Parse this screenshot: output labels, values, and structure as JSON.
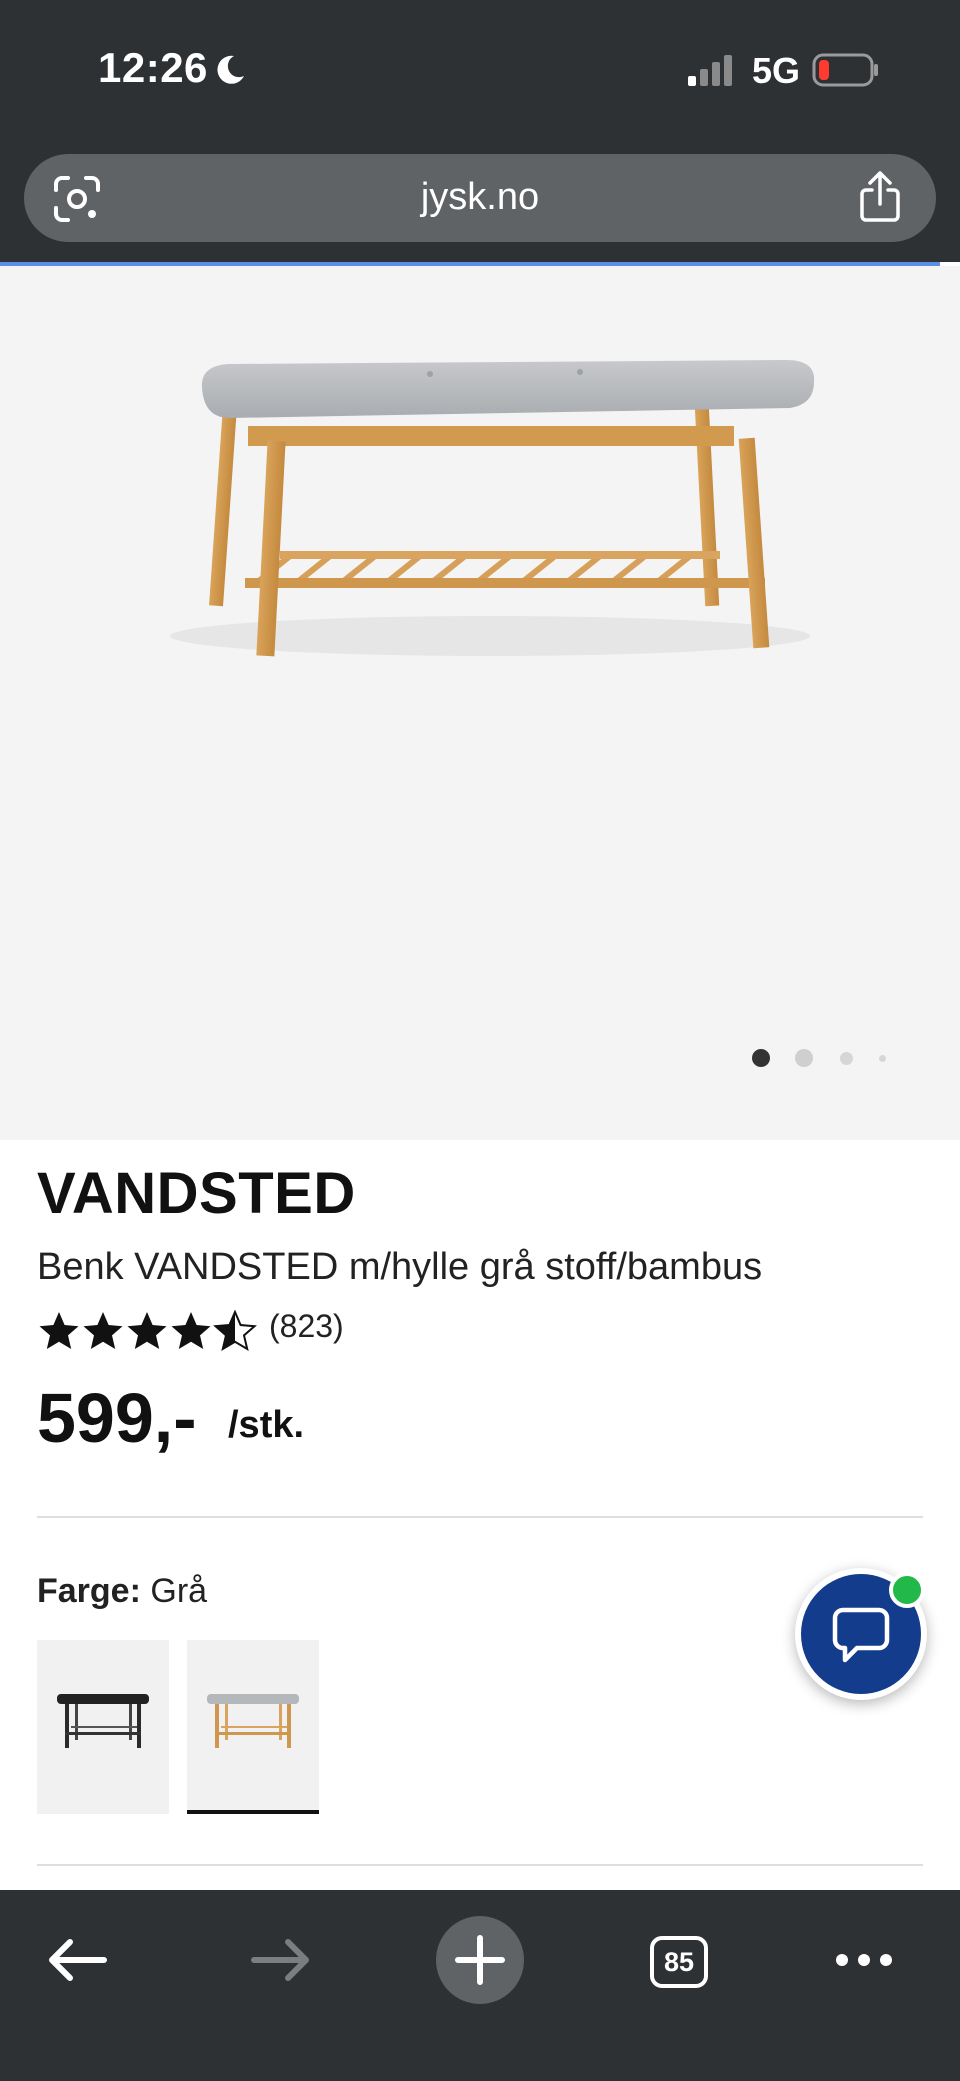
{
  "status_bar": {
    "time": "12:26",
    "network": "5G",
    "icons": [
      "moon-icon",
      "signal-icon",
      "battery-low-icon"
    ]
  },
  "browser": {
    "url": "jysk.no",
    "tab_count": "85",
    "toolbar_icons": [
      "back-arrow-icon",
      "forward-arrow-icon",
      "plus-icon",
      "tabs-icon",
      "more-icon"
    ],
    "accent_color": "#5b8ee6"
  },
  "gallery": {
    "image_count": 4,
    "active_index": 0
  },
  "product": {
    "brand": "VANDSTED",
    "name": "Benk VANDSTED m/hylle grå stoff/bambus",
    "rating": 4.5,
    "rating_max": 5,
    "review_count": "(823)",
    "price": "599,-",
    "price_unit": "/stk."
  },
  "color_selector": {
    "label": "Farge:",
    "selected": "Grå",
    "options": [
      {
        "name": "black-bench",
        "selected": false
      },
      {
        "name": "grey-bamboo-bench",
        "selected": true
      }
    ]
  },
  "chat": {
    "brand_color": "#143c8c",
    "online_color": "#21b94a"
  }
}
